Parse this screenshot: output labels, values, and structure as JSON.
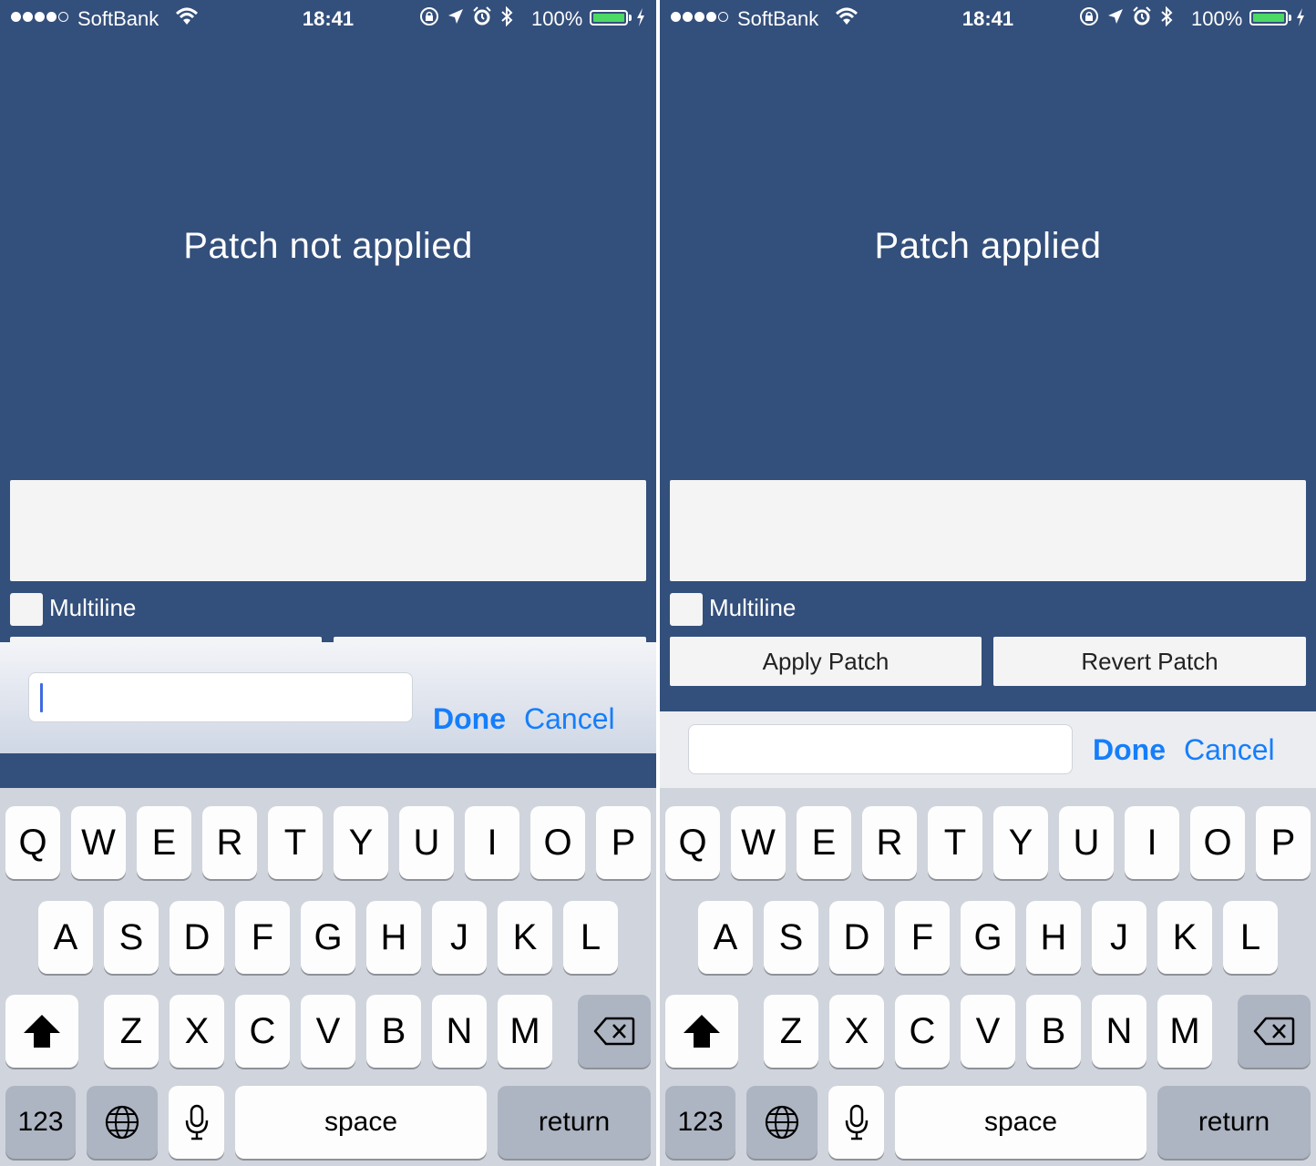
{
  "screens": [
    {
      "status_bar": {
        "carrier": "SoftBank",
        "time": "18:41",
        "battery": "100%"
      },
      "patch_status": "Patch not applied",
      "multiline_label": "Multiline",
      "buttons": {
        "apply": "",
        "revert": ""
      },
      "accessory": {
        "input_value": "",
        "done": "Done",
        "cancel": "Cancel"
      }
    },
    {
      "status_bar": {
        "carrier": "SoftBank",
        "time": "18:41",
        "battery": "100%"
      },
      "patch_status": "Patch applied",
      "multiline_label": "Multiline",
      "buttons": {
        "apply": "Apply Patch",
        "revert": "Revert Patch"
      },
      "accessory": {
        "input_value": "",
        "done": "Done",
        "cancel": "Cancel"
      }
    }
  ],
  "keyboard": {
    "row1": [
      "Q",
      "W",
      "E",
      "R",
      "T",
      "Y",
      "U",
      "I",
      "O",
      "P"
    ],
    "row2": [
      "A",
      "S",
      "D",
      "F",
      "G",
      "H",
      "J",
      "K",
      "L"
    ],
    "row3": [
      "Z",
      "X",
      "C",
      "V",
      "B",
      "N",
      "M"
    ],
    "bottom": {
      "numbers": "123",
      "space": "space",
      "return": "return"
    }
  },
  "colors": {
    "background": "#334f7b",
    "accent": "#157efb",
    "battery": "#4cd964"
  },
  "icons": [
    "wifi-icon",
    "orientation-lock-icon",
    "location-icon",
    "alarm-icon",
    "bluetooth-icon",
    "battery-icon",
    "charging-icon",
    "shift-icon",
    "backspace-icon",
    "globe-icon",
    "microphone-icon"
  ]
}
